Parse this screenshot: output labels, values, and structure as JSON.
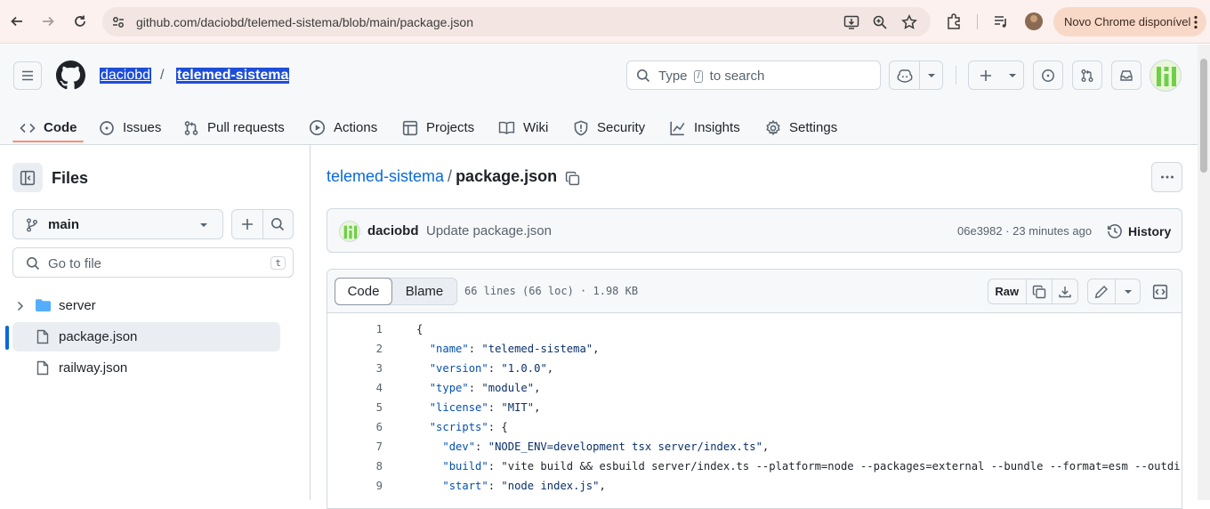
{
  "browser": {
    "url": "github.com/daciobd/telemed-sistema/blob/main/package.json",
    "update_label": "Novo Chrome disponível"
  },
  "header": {
    "owner": "daciobd",
    "separator": "/",
    "repo": "telemed-sistema",
    "search": {
      "prefix": "Type",
      "key": "/",
      "suffix": "to search"
    }
  },
  "tabs": [
    {
      "label": "Code",
      "icon": "code-icon"
    },
    {
      "label": "Issues",
      "icon": "issue-icon"
    },
    {
      "label": "Pull requests",
      "icon": "pull-request-icon"
    },
    {
      "label": "Actions",
      "icon": "play-icon"
    },
    {
      "label": "Projects",
      "icon": "table-icon"
    },
    {
      "label": "Wiki",
      "icon": "book-icon"
    },
    {
      "label": "Security",
      "icon": "shield-icon"
    },
    {
      "label": "Insights",
      "icon": "graph-icon"
    },
    {
      "label": "Settings",
      "icon": "gear-icon"
    }
  ],
  "sidebar": {
    "title": "Files",
    "branch": "main",
    "goto_placeholder": "Go to file",
    "goto_key": "t",
    "items": [
      {
        "label": "server",
        "type": "folder"
      },
      {
        "label": "package.json",
        "type": "file"
      },
      {
        "label": "railway.json",
        "type": "file"
      }
    ]
  },
  "main": {
    "path_repo": "telemed-sistema",
    "path_sep": "/",
    "path_file": "package.json",
    "commit": {
      "author": "daciobd",
      "message": "Update package.json",
      "meta": "06e3982 · 23 minutes ago",
      "history_label": "History"
    },
    "code_tab": "Code",
    "blame_tab": "Blame",
    "stats": "66 lines (66 loc) · 1.98 KB",
    "raw_label": "Raw",
    "lines": [
      {
        "n": "1",
        "text": "{"
      },
      {
        "n": "2",
        "text": "  \"name\": \"telemed-sistema\","
      },
      {
        "n": "3",
        "text": "  \"version\": \"1.0.0\","
      },
      {
        "n": "4",
        "text": "  \"type\": \"module\","
      },
      {
        "n": "5",
        "text": "  \"license\": \"MIT\","
      },
      {
        "n": "6",
        "text": "  \"scripts\": {"
      },
      {
        "n": "7",
        "text": "    \"dev\": \"NODE_ENV=development tsx server/index.ts\","
      },
      {
        "n": "8",
        "text": "    \"build\": \"vite build && esbuild server/index.ts --platform=node --packages=external --bundle --format=esm --outdir="
      },
      {
        "n": "9",
        "text": "    \"start\": \"node index.js\","
      }
    ]
  },
  "colors": {
    "accent": "#0969da",
    "tab_underline": "#fd8c73",
    "key_string": "#0a3069",
    "key_name": "#0550ae"
  }
}
